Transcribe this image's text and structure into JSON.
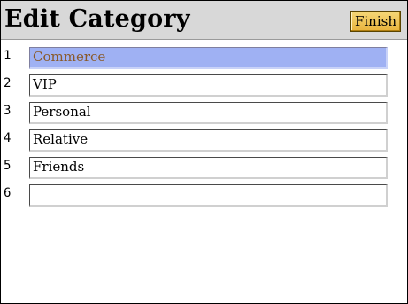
{
  "header": {
    "title": "Edit Category",
    "finish_label": "Finish"
  },
  "categories": [
    {
      "number": "1",
      "name": "Commerce",
      "selected": true
    },
    {
      "number": "2",
      "name": "VIP",
      "selected": false
    },
    {
      "number": "3",
      "name": "Personal",
      "selected": false
    },
    {
      "number": "4",
      "name": "Relative",
      "selected": false
    },
    {
      "number": "5",
      "name": "Friends",
      "selected": false
    },
    {
      "number": "6",
      "name": "",
      "selected": false
    }
  ],
  "colors": {
    "header_background": "#d8d8d8",
    "selected_field": "#9fb1f3",
    "selected_text": "#8a5a2a",
    "finish_button": "#e9b33c"
  }
}
